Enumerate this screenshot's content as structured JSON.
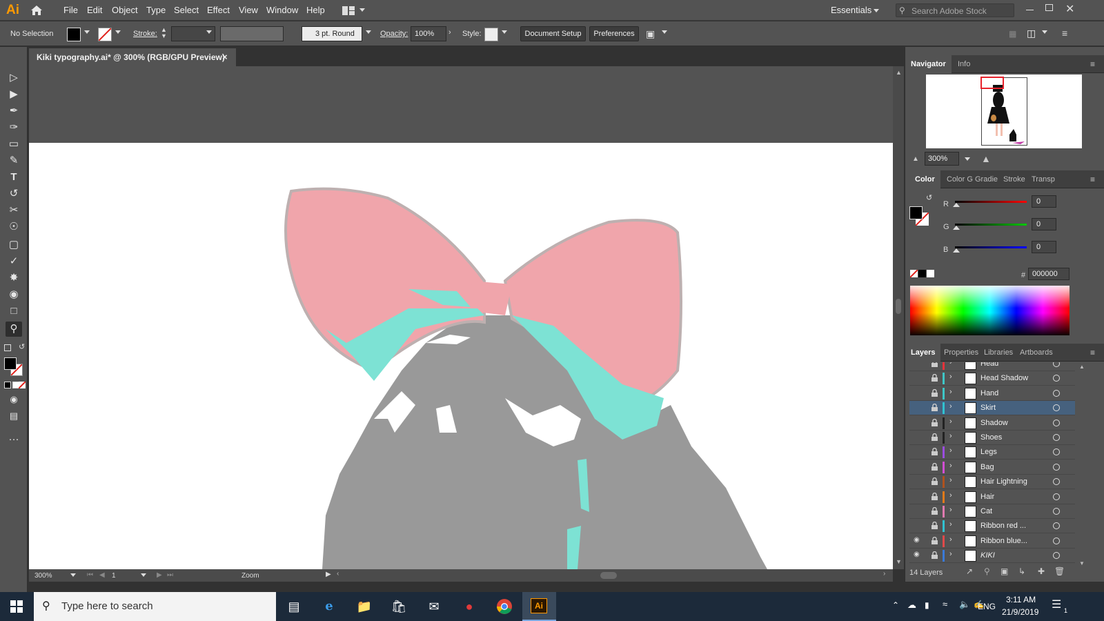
{
  "app": {
    "logo": "Ai",
    "workspace": "Essentials",
    "search_stock_placeholder": "Search Adobe Stock"
  },
  "menu": [
    "File",
    "Edit",
    "Object",
    "Type",
    "Select",
    "Effect",
    "View",
    "Window",
    "Help"
  ],
  "control_bar": {
    "selection": "No Selection",
    "stroke_label": "Stroke:",
    "brush": "3 pt. Round",
    "opacity_label": "Opacity:",
    "opacity": "100%",
    "style_label": "Style:",
    "document_setup": "Document Setup",
    "preferences": "Preferences"
  },
  "document": {
    "tab_title": "Kiki typography.ai* @ 300% (RGB/GPU Preview)"
  },
  "status": {
    "zoom": "300%",
    "artboard": "1",
    "tool": "Zoom"
  },
  "navigator": {
    "tabs": [
      "Navigator",
      "Info"
    ],
    "zoom": "300%"
  },
  "color_panel": {
    "tabs": [
      "Color",
      "Color G",
      "Gradie",
      "Stroke",
      "Transp"
    ],
    "r_label": "R",
    "g_label": "G",
    "b_label": "B",
    "r": "0",
    "g": "0",
    "b": "0",
    "hex_label": "#",
    "hex": "000000"
  },
  "layers_panel": {
    "tabs": [
      "Layers",
      "Properties",
      "Libraries",
      "Artboards"
    ],
    "count": "14 Layers",
    "layers": [
      {
        "name": "Head",
        "color": "#e8333a"
      },
      {
        "name": "Head Shadow",
        "color": "#3ec6c6"
      },
      {
        "name": "Hand",
        "color": "#3ec6c6"
      },
      {
        "name": "Skirt",
        "color": "#31c1d0"
      },
      {
        "name": "Shadow",
        "color": "#222222"
      },
      {
        "name": "Shoes",
        "color": "#222222"
      },
      {
        "name": "Legs",
        "color": "#9b4de0"
      },
      {
        "name": "Bag",
        "color": "#d24ed4"
      },
      {
        "name": "Hair Lightning",
        "color": "#b0521e"
      },
      {
        "name": "Hair",
        "color": "#e07a1a"
      },
      {
        "name": "Cat",
        "color": "#e07ab0"
      },
      {
        "name": "Ribbon red ...",
        "color": "#31c1d0"
      },
      {
        "name": "Ribbon blue...",
        "color": "#e04a4a"
      },
      {
        "name": "KIKI",
        "color": "#3a7ad8"
      }
    ]
  },
  "taskbar": {
    "search_placeholder": "Type here to search",
    "time": "3:11 AM",
    "date": "21/9/2019",
    "lang": "ENG",
    "notif": "1"
  }
}
